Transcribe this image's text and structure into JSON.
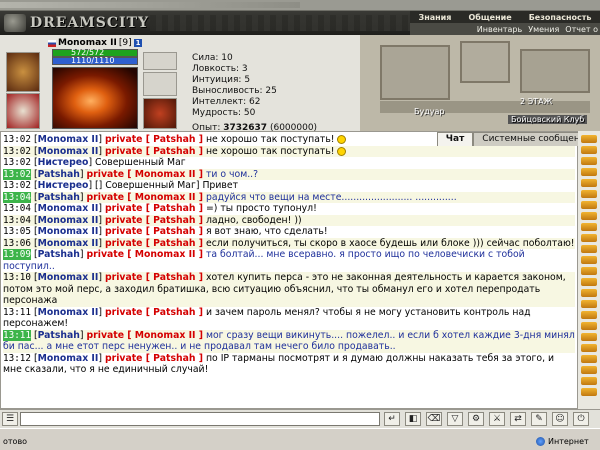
{
  "logo_text": "DREAMSCITY",
  "top_menu": {
    "row1": [
      "Знания",
      "Общение",
      "Безопасность"
    ],
    "row2": [
      "Инвентарь",
      "Умения",
      "Отчет о"
    ]
  },
  "character": {
    "nick": "Monomax II",
    "level": "[9]",
    "badge": "1",
    "hp_text": "572/572",
    "mp_text": "1110/1110",
    "hp_fraction": 1.0,
    "mp_fraction": 1.0,
    "stats": [
      "Сила: 10",
      "Ловкость: 3",
      "Интуиция: 5",
      "Выносливость: 25",
      "Интеллект: 62",
      "Мудрость: 50"
    ],
    "exp_label": "Опыт:",
    "exp_value": "3732637",
    "exp_next": "(6000000)"
  },
  "map": {
    "label1": "Будуар",
    "label2": "2 ЭТАЖ",
    "label3": "Бойцовский Клуб"
  },
  "tabs": [
    "Чат",
    "Системные сообщения"
  ],
  "chat": [
    {
      "time": "13:02",
      "sender": "Monomax II",
      "to": "private [ Patshah ]",
      "text": "не хорошо так поступать!",
      "color": "normal",
      "smile": true
    },
    {
      "time": "13:02",
      "sender": "Monomax II",
      "to": "private [ Patshah ]",
      "text": "не хорошо так поступать!",
      "color": "normal",
      "smile": true
    },
    {
      "time": "13:02",
      "sender": "Нистерео",
      "to": "",
      "text": "Совершенный Маг",
      "color": "normal"
    },
    {
      "time": "13:02",
      "sender": "Patshah",
      "to": "private [ Monomax II ]",
      "text": "ти о чом..?",
      "color": "blue",
      "green": true
    },
    {
      "time": "13:02",
      "sender": "Нистерео",
      "to": "",
      "text": "[] Совершенный Маг] Привет",
      "color": "normal"
    },
    {
      "time": "13:04",
      "sender": "Patshah",
      "to": "private [ Monomax II ]",
      "text": "радуйся что вещи на месте........................ ..............",
      "color": "blue",
      "green": true
    },
    {
      "time": "13:04",
      "sender": "Monomax II",
      "to": "private [ Patshah ]",
      "text": "=) ты просто тупонул!",
      "color": "normal"
    },
    {
      "time": "13:04",
      "sender": "Monomax II",
      "to": "private [ Patshah ]",
      "text": "ладно, свободен! ))",
      "color": "normal"
    },
    {
      "time": "13:05",
      "sender": "Monomax II",
      "to": "private [ Patshah ]",
      "text": "я вот знаю, что сделать!",
      "color": "normal"
    },
    {
      "time": "13:06",
      "sender": "Monomax II",
      "to": "private [ Patshah ]",
      "text": "если получиться, ты скоро в хаосе будешь или блоке ))) сейчас поболтаю!",
      "color": "normal"
    },
    {
      "time": "13:09",
      "sender": "Patshah",
      "to": "private [ Monomax II ]",
      "text": "та болтай... мне всеравно. я просто ищо по человечиски с тобой поступил..",
      "color": "blue",
      "green": true
    },
    {
      "time": "13:10",
      "sender": "Monomax II",
      "to": "private [ Patshah ]",
      "text": "хотел купить перса - это не законная деятельность и карается законом, потом это мой перс, а заходил братишка, всю ситуацию объяснил, что ты обманул его и хотел перепродать персонажа",
      "color": "normal"
    },
    {
      "time": "13:11",
      "sender": "Monomax II",
      "to": "private [ Patshah ]",
      "text": "и зачем пароль менял? чтобы я не могу установить контроль над персонажем!",
      "color": "normal"
    },
    {
      "time": "13:11",
      "sender": "Patshah",
      "to": "private [ Monomax II ]",
      "text": "мог сразу вещи викинуть.... пожелел.. и если б хотел каждие 3-дня минял би пас... а мне етот перс ненужен.. и не продавал там нечего било продавать..",
      "color": "blue",
      "green": true
    },
    {
      "time": "13:12",
      "sender": "Monomax II",
      "to": "private [ Patshah ]",
      "text": "по IP тарманы посмотрят и я думаю должны наказать тебя за этого, и мне сказали, что я не единичный случай!",
      "color": "normal"
    }
  ],
  "status": {
    "left": "отово",
    "right": "Интернет"
  },
  "colors": {
    "private": "#d40000",
    "nick": "#1b2f8e",
    "time_highlight": "#3cb44a"
  }
}
